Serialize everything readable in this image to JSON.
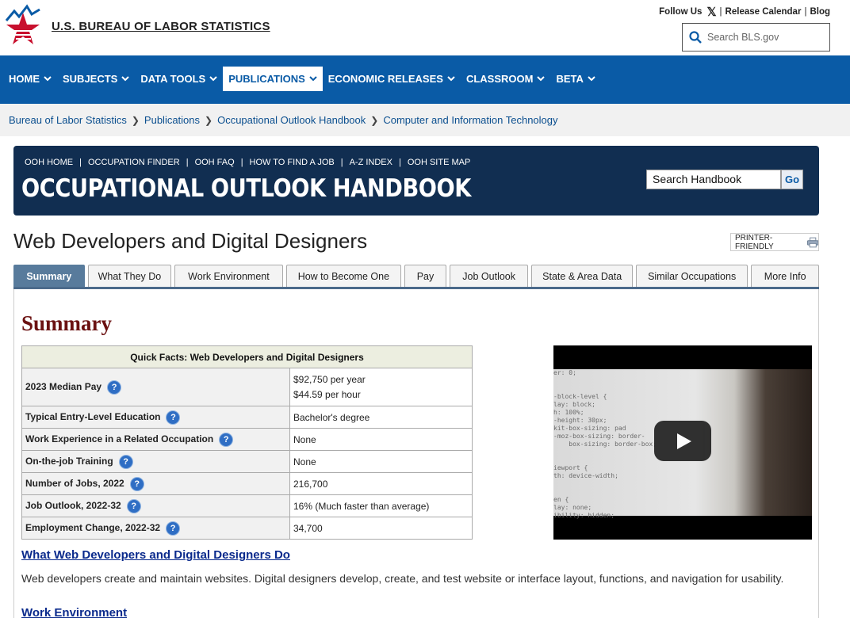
{
  "header": {
    "agency": "U.S. BUREAU OF LABOR STATISTICS",
    "util_follow": "Follow Us",
    "util_release": "Release Calendar",
    "util_blog": "Blog",
    "search_placeholder": "Search BLS.gov"
  },
  "nav": [
    {
      "label": "HOME"
    },
    {
      "label": "SUBJECTS"
    },
    {
      "label": "DATA TOOLS"
    },
    {
      "label": "PUBLICATIONS",
      "active": true
    },
    {
      "label": "ECONOMIC RELEASES"
    },
    {
      "label": "CLASSROOM"
    },
    {
      "label": "BETA"
    }
  ],
  "breadcrumb": [
    "Bureau of Labor Statistics",
    "Publications",
    "Occupational Outlook Handbook",
    "Computer and Information Technology"
  ],
  "ooh": {
    "links": [
      "OOH HOME",
      "OCCUPATION FINDER",
      "OOH FAQ",
      "HOW TO FIND A JOB",
      "A-Z INDEX",
      "OOH SITE MAP"
    ],
    "title": "OCCUPATIONAL OUTLOOK HANDBOOK",
    "search_value": "Search Handbook",
    "go_label": "Go"
  },
  "page": {
    "title": "Web Developers and Digital Designers",
    "printer_label": "PRINTER-FRIENDLY"
  },
  "tabs": [
    {
      "label": "Summary",
      "active": true
    },
    {
      "label": "What They Do"
    },
    {
      "label": "Work Environment"
    },
    {
      "label": "How to Become One"
    },
    {
      "label": "Pay"
    },
    {
      "label": "Job Outlook"
    },
    {
      "label": "State & Area Data"
    },
    {
      "label": "Similar Occupations"
    },
    {
      "label": "More Info"
    }
  ],
  "summary": {
    "heading": "Summary",
    "quick_facts_title": "Quick Facts: Web Developers and Digital Designers",
    "facts": [
      {
        "label": "2023 Median Pay",
        "value": "$92,750 per year",
        "value2": "$44.59 per hour"
      },
      {
        "label": "Typical Entry-Level Education",
        "value": "Bachelor's degree"
      },
      {
        "label": "Work Experience in a Related Occupation",
        "value": "None"
      },
      {
        "label": "On-the-job Training",
        "value": "None"
      },
      {
        "label": "Number of Jobs, 2022",
        "value": "216,700"
      },
      {
        "label": "Job Outlook, 2022-32",
        "value": "16% (Much faster than average)"
      },
      {
        "label": "Employment Change, 2022-32",
        "value": "34,700"
      }
    ],
    "help_glyph": "?",
    "section1_link": "What Web Developers and Digital Designers Do",
    "section1_text": "Web developers create and maintain websites. Digital designers develop, create, and test website or interface layout, functions, and navigation for usability.",
    "section2_link": "Work Environment"
  },
  "video": {
    "code_text": "er: 0;\n\n\n-block-level {\nlay: block;\nh: 100%;\n-height: 30px;\nkit-box-sizing: pad\n-moz-box-sizing: border-\n    box-sizing: border-box;\n\n\niewport {\nth: device-width;\n\n\nen {\nlay: none;\nibility: hidden;"
  },
  "colors": {
    "nav_bg": "#0a5ba6",
    "ooh_bg": "#112e51",
    "summary_heading": "#6b1111",
    "tab_active": "#587b9c"
  }
}
